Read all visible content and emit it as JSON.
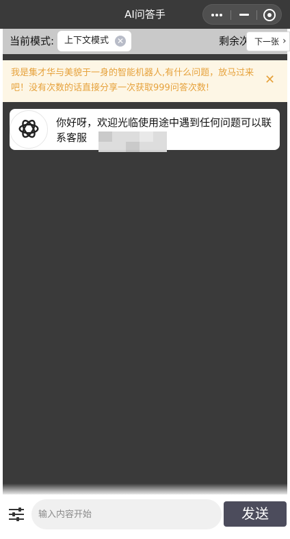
{
  "nav": {
    "title": "AI问答手",
    "capsule": {
      "more_icon": "more-dots-icon",
      "minimize_icon": "minimize-icon",
      "close_icon": "target-close-icon"
    }
  },
  "mode_bar": {
    "label": "当前模式:",
    "mode_chip": "上下文模式",
    "clear_icon": "clear-circle-icon",
    "remaining_label": "剩余次",
    "next_button": "下一张",
    "next_icon": "chevron-right-icon"
  },
  "notice": {
    "text": "我是集才华与美貌于一身的智能机器人,有什么问题，放马过来吧！没有次数的话直接分享一次获取999问答次数!",
    "close_symbol": "✕"
  },
  "messages": [
    {
      "role": "bot",
      "avatar_icon": "openai-logo-icon",
      "text": "你好呀，欢迎光临使用途中遇到任何问题可以联系客服"
    }
  ],
  "input_bar": {
    "settings_icon": "sliders-icon",
    "placeholder": "输入内容开始",
    "send_label": "发送"
  },
  "colors": {
    "nav_bg": "#3a3a3a",
    "notice_text": "#e6a23c",
    "notice_bg": "#fdf6e5",
    "send_bg": "#4c4c5c"
  }
}
